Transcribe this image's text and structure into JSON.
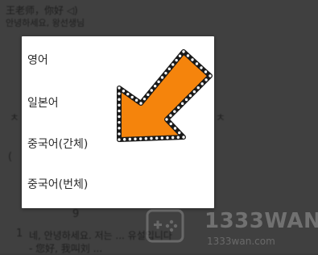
{
  "background": {
    "top_lines": [
      "王老师，你好 ◁)",
      "안녕하세요, 왕선생님"
    ],
    "bottom_lines": [
      "네, 안녕하세요. 저는 ... 유설입니다",
      "- 您好, 我叫刘 ..."
    ],
    "gutter_marks": [
      "ㅊ",
      "ㅊ",
      "(",
      "9",
      "1"
    ]
  },
  "language_dialog": {
    "options": [
      {
        "label": "영어"
      },
      {
        "label": "일본어"
      },
      {
        "label": "중국어(간체)"
      },
      {
        "label": "중국어(번체)"
      }
    ]
  },
  "overlay": {
    "arrow_color": "#f5840c",
    "arrow_outline": "#1a1a1a",
    "arrow_dots": "#ffffff"
  },
  "watermark": {
    "title": "1333WAN",
    "url": "1333wan.com"
  }
}
